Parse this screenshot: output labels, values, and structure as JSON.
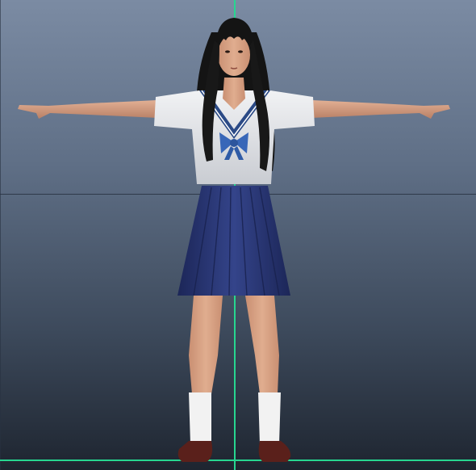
{
  "viewport": {
    "background_top": "#7b8ba3",
    "background_bottom": "#1e2530",
    "axis_color": "#27d690",
    "origin_marker": "o"
  },
  "model": {
    "pose": "T-pose",
    "colors": {
      "skin": "#d9a384",
      "hair": "#151515",
      "blouse": "#e9ebee",
      "collar_trim": "#2b4a86",
      "bow": "#3867b8",
      "skirt": "#2a3873",
      "socks": "#f2f2f2",
      "shoes": "#5a201b"
    }
  }
}
